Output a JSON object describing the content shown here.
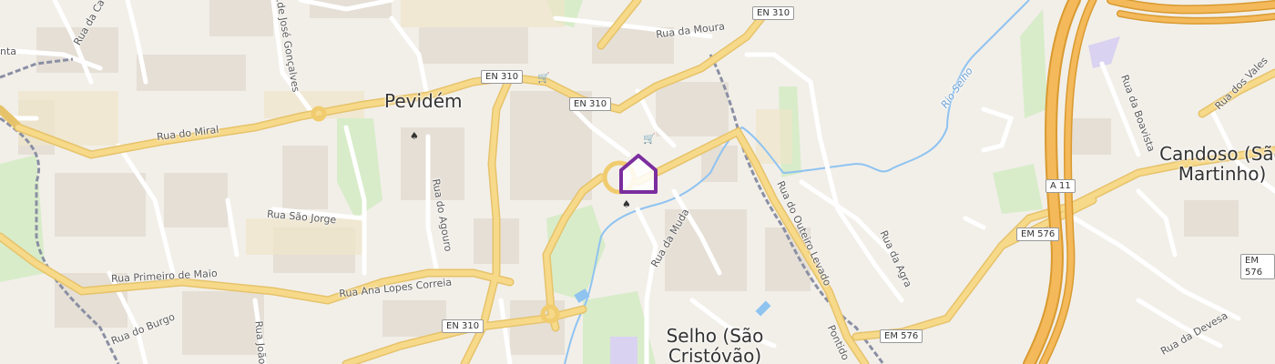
{
  "colors": {
    "background": "#f2efe9",
    "building": "#e3ddd3",
    "green": "#d5ecc7",
    "water": "#8fc3f0",
    "major_road": "#f7d37a",
    "motorway": "#f1b84a",
    "minor_road": "#ffffff",
    "railway": "#8a8fa3",
    "marker": "#7b2e9e"
  },
  "places": {
    "pevidem": "Pevidém",
    "selho_line1": "Selho (São",
    "selho_line2": "Cristóvão)",
    "candoso_line1": "Candoso (São",
    "candoso_line2": "Martinho)"
  },
  "road_shields": {
    "en310_top": "EN 310",
    "en310_a": "EN 310",
    "en310_b": "EN 310",
    "en310_bottom": "EN 310",
    "a11": "A 11",
    "em576_a": "EM 576",
    "em576_b": "EM 576",
    "em576_c": "EM 576"
  },
  "streets": {
    "rua_da_moura": "Rua da Moura",
    "rua_do_miral": "Rua do Miral",
    "rua_sao_jorge": "Rua São Jorge",
    "rua_do_agouro": "Rua do Agouro",
    "rua_primeiro_de_maio": "Rua Primeiro de Maio",
    "rua_ana_lopes_correia": "Rua Ana Lopes Correia",
    "rua_do_burgo": "Rua do Burgo",
    "rua_da_muda": "Rua da Muda",
    "rua_do_outeiro_levado": "Rua do Outeiro Levado",
    "rua_da_agra": "Rua da Agra",
    "rua_da_boavista": "Rua da Boavista",
    "rua_dos_vales": "Rua dos Vales",
    "rua_da_devesa": "Rua da Devesa",
    "rua_jose_goncalves": "...de José Gonçalves",
    "rua_joao": "Rua João",
    "rua_ca": "Rua da Ca",
    "pontido": "Pontido",
    "nta": "nta"
  },
  "water": {
    "rio_selho": "Rio Selho"
  },
  "poi_icons": [
    "basket-icon",
    "basket-icon",
    "clothing-icon",
    "clothing-icon"
  ],
  "marker": {
    "icon": "location-pin-icon"
  }
}
